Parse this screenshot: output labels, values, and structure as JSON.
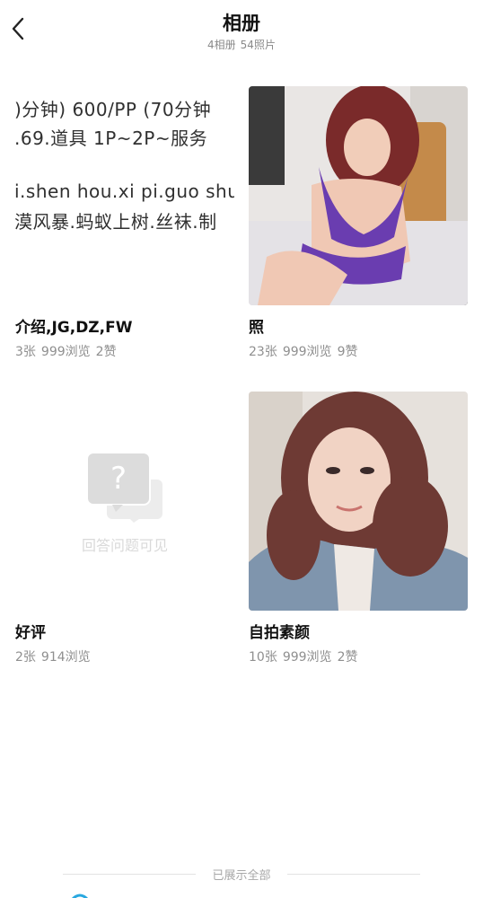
{
  "header": {
    "title": "相册",
    "album_count": "4相册",
    "photo_count": "54照片"
  },
  "albums": [
    {
      "title": "介绍,JG,DZ,FW",
      "count": "3张",
      "views": "999浏览",
      "likes": "2赞",
      "thumb_text": [
        ")分钟)   600/PP  (70分钟",
        ".69.道具     1P~2P~服务",
        "i.shen hou.xi pi.guo shu",
        "漠风暴.蚂蚁上树.丝袜.制"
      ]
    },
    {
      "title": "照",
      "count": "23张",
      "views": "999浏览",
      "likes": "9赞"
    },
    {
      "title": "好评",
      "count": "2张",
      "views": "914浏览",
      "lock_text": "回答问题可见"
    },
    {
      "title": "自拍素颜",
      "count": "10张",
      "views": "999浏览",
      "likes": "2赞"
    }
  ],
  "footer": {
    "end_text": "已展示全部"
  }
}
